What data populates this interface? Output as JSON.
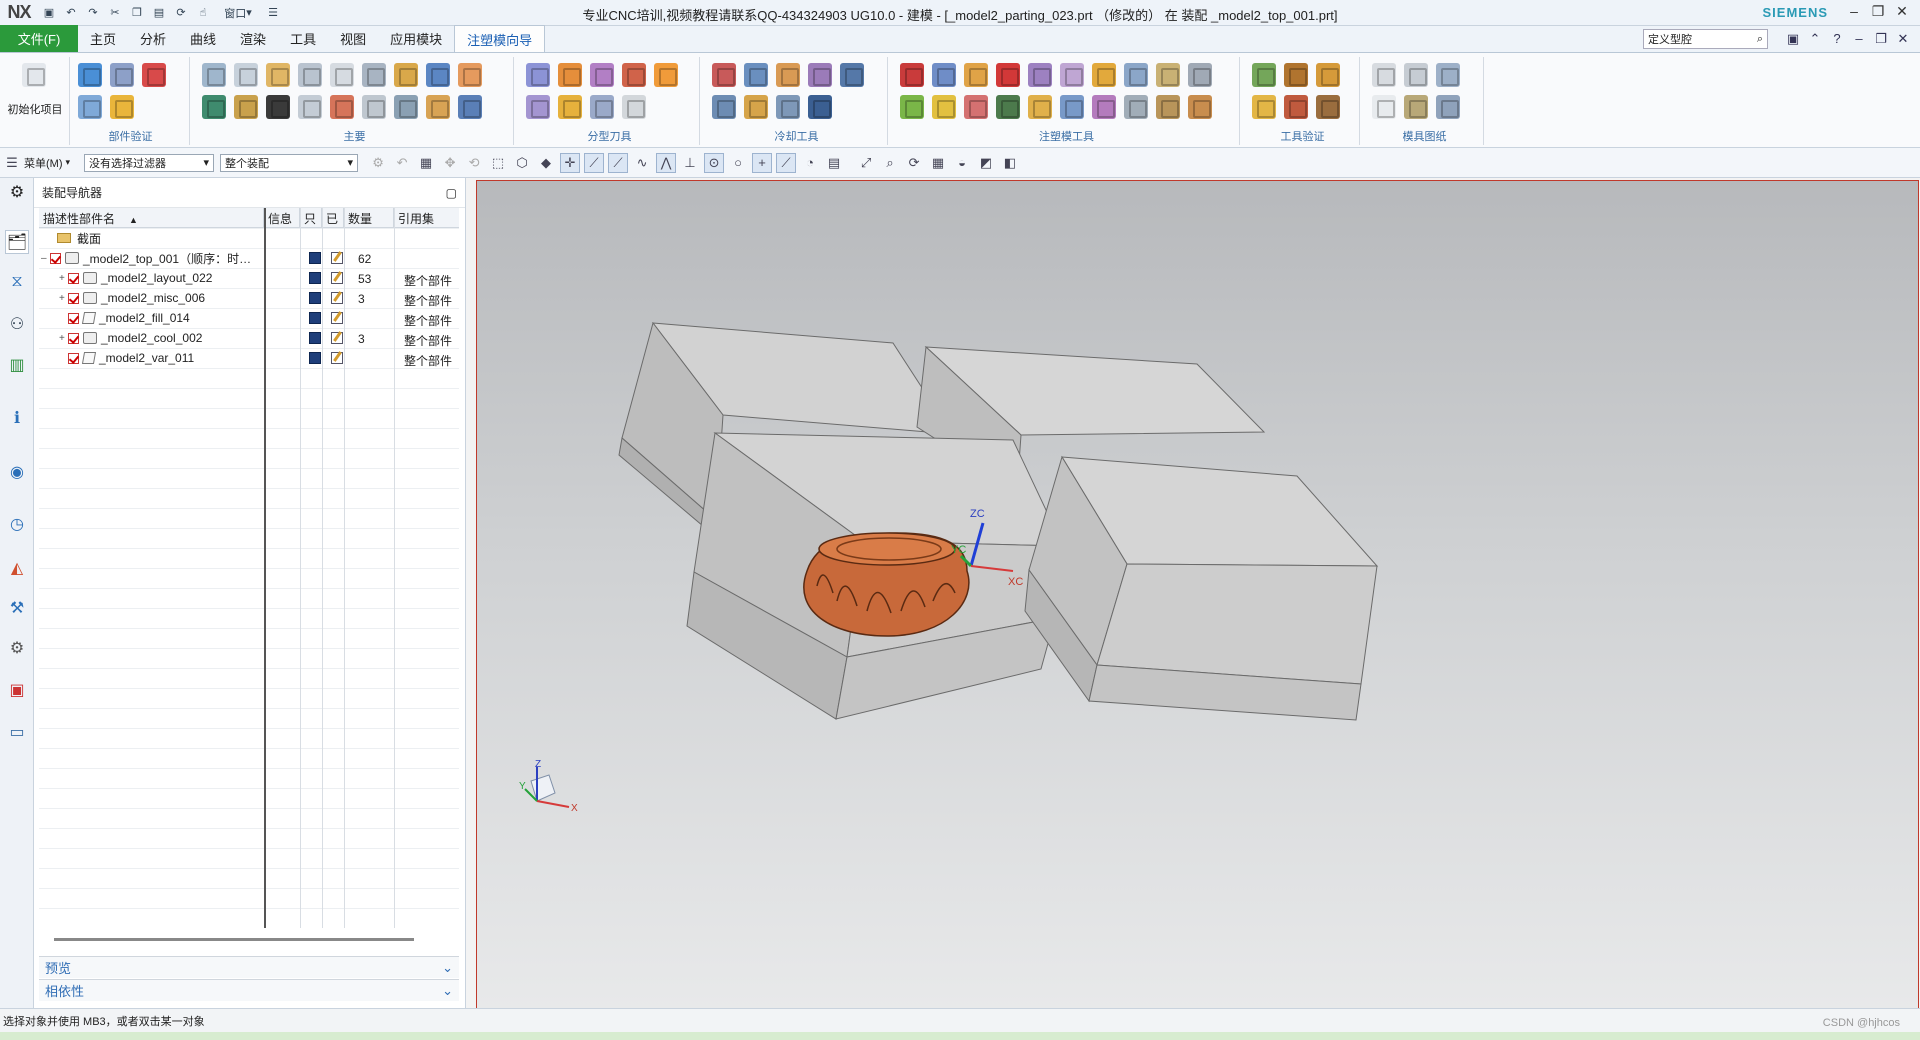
{
  "titlebar": {
    "logo": "NX",
    "window_title": "专业CNC培训,视频教程请联系QQ-434324903 UG10.0 - 建模 - [_model2_parting_023.prt （修改的） 在 装配 _model2_top_001.prt]",
    "brand": "SIEMENS",
    "menu_dropdown": "窗口"
  },
  "menubar": {
    "file_label": "文件(F)",
    "tabs": [
      "主页",
      "分析",
      "曲线",
      "渲染",
      "工具",
      "视图",
      "应用模块",
      "注塑模向导"
    ],
    "active_tab": "注塑模向导",
    "search_placeholder": "定义型腔"
  },
  "ribbon": {
    "init_label": "初始化项目",
    "groups": [
      "部件验证",
      "主要",
      "分型刀具",
      "冷却工具",
      "注塑模工具",
      "工具验证",
      "模具图纸"
    ]
  },
  "cmdbar": {
    "menu_label": "菜单(M)",
    "filter_value": "没有选择过滤器",
    "scope_value": "整个装配"
  },
  "navigator": {
    "title": "装配导航器",
    "columns": [
      "描述性部件名",
      "信息",
      "只",
      "已",
      "数量",
      "引用集"
    ],
    "rows": [
      {
        "name": "截面",
        "count": "",
        "refset": ""
      },
      {
        "name": "_model2_top_001（顺序：时…",
        "count": "62",
        "refset": ""
      },
      {
        "name": "_model2_layout_022",
        "count": "53",
        "refset": "整个部件"
      },
      {
        "name": "_model2_misc_006",
        "count": "3",
        "refset": "整个部件"
      },
      {
        "name": "_model2_fill_014",
        "count": "",
        "refset": "整个部件"
      },
      {
        "name": "_model2_cool_002",
        "count": "3",
        "refset": "整个部件"
      },
      {
        "name": "_model2_var_011",
        "count": "",
        "refset": "整个部件"
      }
    ],
    "footer_preview": "预览",
    "footer_dependency": "相依性"
  },
  "viewport": {
    "axis_zc": "ZC",
    "axis_yc": "YC",
    "axis_xc": "XC",
    "triad_z": "Z",
    "triad_y": "Y",
    "triad_x": "X",
    "colors": {
      "part": "#c8693a",
      "block": "#c9c9c9",
      "border": "#c0392b"
    }
  },
  "status": {
    "text": "选择对象并使用 MB3，或者双击某一对象",
    "watermark": "CSDN @hjhcos"
  }
}
